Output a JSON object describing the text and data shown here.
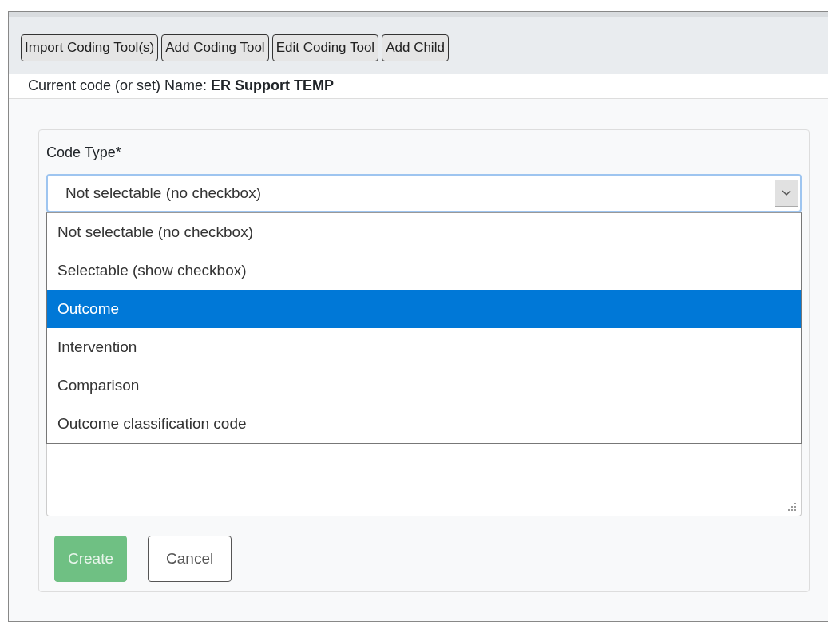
{
  "toolbar": {
    "buttons": [
      "Import Coding Tool(s)",
      "Add Coding Tool",
      "Edit Coding Tool",
      "Add Child"
    ]
  },
  "current": {
    "label": "Current code (or set) Name:",
    "name": "ER Support TEMP"
  },
  "form": {
    "field_label": "Code Type*",
    "select": {
      "value": "Not selectable (no checkbox)",
      "expanded": true,
      "options": [
        {
          "label": "Not selectable (no checkbox)",
          "highlighted": false
        },
        {
          "label": "Selectable (show checkbox)",
          "highlighted": false
        },
        {
          "label": "Outcome",
          "highlighted": true
        },
        {
          "label": "Intervention",
          "highlighted": false
        },
        {
          "label": "Comparison",
          "highlighted": false
        },
        {
          "label": "Outcome classification code",
          "highlighted": false
        }
      ]
    },
    "buttons": [
      {
        "label": "Create",
        "kind": "primary",
        "disabled": true
      },
      {
        "label": "Cancel",
        "kind": "secondary",
        "disabled": false
      }
    ]
  }
}
